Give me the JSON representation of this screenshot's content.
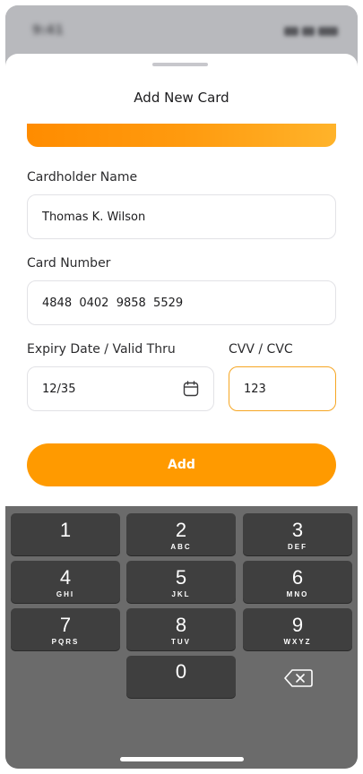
{
  "status_bar": {
    "time": "9:41"
  },
  "sheet": {
    "title": "Add New Card",
    "card_gradient": [
      "#ff8c00",
      "#ffb32a"
    ]
  },
  "form": {
    "cardholder": {
      "label": "Cardholder Name",
      "value": "Thomas K. Wilson"
    },
    "card_number": {
      "label": "Card Number",
      "value": "4848  0402  9858  5529"
    },
    "expiry": {
      "label": "Expiry Date / Valid Thru",
      "value": "12/35"
    },
    "cvv": {
      "label": "CVV / CVC",
      "value": "123"
    },
    "add_label": "Add"
  },
  "colors": {
    "accent": "#ff9a00",
    "focus_border": "#f6a623"
  },
  "keyboard": {
    "keys": [
      {
        "digit": "1",
        "letters": ""
      },
      {
        "digit": "2",
        "letters": "ABC"
      },
      {
        "digit": "3",
        "letters": "DEF"
      },
      {
        "digit": "4",
        "letters": "GHI"
      },
      {
        "digit": "5",
        "letters": "JKL"
      },
      {
        "digit": "6",
        "letters": "MNO"
      },
      {
        "digit": "7",
        "letters": "PQRS"
      },
      {
        "digit": "8",
        "letters": "TUV"
      },
      {
        "digit": "9",
        "letters": "WXYZ"
      },
      {
        "digit": "0",
        "letters": ""
      }
    ],
    "delete_icon": "backspace-icon"
  }
}
